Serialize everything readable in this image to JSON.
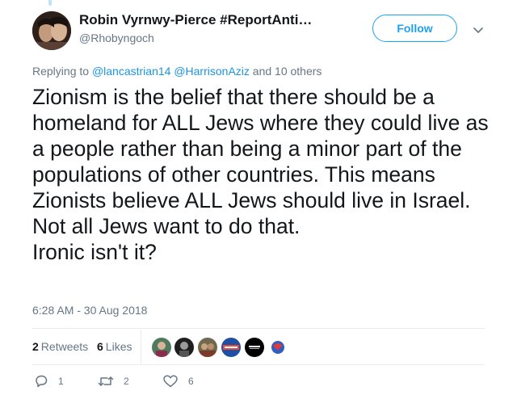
{
  "tweet": {
    "author_name": "Robin Vyrnwy-Pierce #ReportAnti…",
    "author_handle": "@Rhobyngoch",
    "follow_label": "Follow",
    "replying_prefix": "Replying to",
    "replying_users": [
      "@lancastrian14",
      "@HarrisonAziz"
    ],
    "replying_suffix": "and 10 others",
    "text_lines": [
      "Zionism is the belief that there should be a homeland for ALL Jews where they could live as a people rather than being a minor part of the populations of other countries. This means Zionists believe ALL Jews should live in Israel.",
      "Not all Jews want to do that.",
      "Ironic isn't it?"
    ],
    "timestamp": "6:28 AM - 30 Aug 2018"
  },
  "stats": {
    "retweets_count": "2",
    "retweets_label": "Retweets",
    "likes_count": "6",
    "likes_label": "Likes"
  },
  "likers": [
    "avatar-1",
    "avatar-2",
    "avatar-3",
    "avatar-4",
    "avatar-5",
    "avatar-6"
  ],
  "actions": {
    "reply_count": "1",
    "retweet_count": "2",
    "like_count": "6"
  },
  "colors": {
    "accent": "#1da1f2",
    "link": "#1b95e0",
    "muted": "#657786",
    "text": "#14171a",
    "divider": "#e6ecf0"
  }
}
